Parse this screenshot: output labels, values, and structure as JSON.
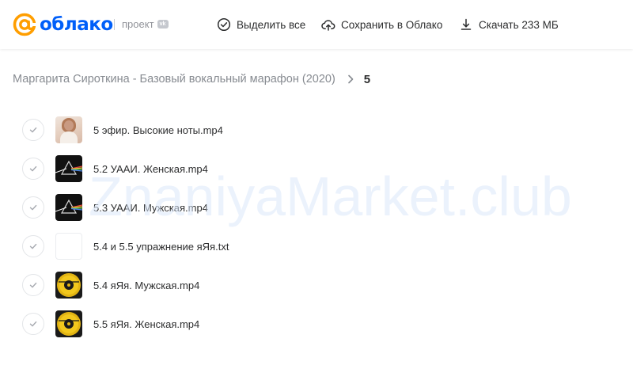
{
  "header": {
    "logo_text": "облако",
    "project_label": "проект",
    "project_badge": "vk",
    "actions": [
      {
        "label": "Выделить все",
        "icon": "check-circle-icon"
      },
      {
        "label": "Сохранить в Облако",
        "icon": "cloud-upload-icon"
      },
      {
        "label": "Скачать 233 МБ",
        "icon": "download-icon"
      }
    ]
  },
  "breadcrumb": {
    "parent": "Маргарита Сироткина - Базовый вокальный марафон (2020)",
    "current": "5"
  },
  "files": [
    {
      "name": "5 эфир. Высокие ноты.mp4",
      "thumbnail": "photo"
    },
    {
      "name": "5.2 УААИ. Женская.mp4",
      "thumbnail": "prism"
    },
    {
      "name": "5.3 УААИ. Мужская.mp4",
      "thumbnail": "prism"
    },
    {
      "name": "5.4 и 5.5 упражнение яЯя.txt",
      "thumbnail": "document"
    },
    {
      "name": "5.4 яЯя. Мужская.mp4",
      "thumbnail": "disc"
    },
    {
      "name": "5.5 яЯя. Женская.mp4",
      "thumbnail": "disc"
    }
  ],
  "watermark": "ZnaniyaMarket.club",
  "colors": {
    "brand_blue": "#005ff9",
    "logo_orange": "#ff9e00",
    "text_primary": "#2c2d2e",
    "text_secondary": "#878b91"
  }
}
